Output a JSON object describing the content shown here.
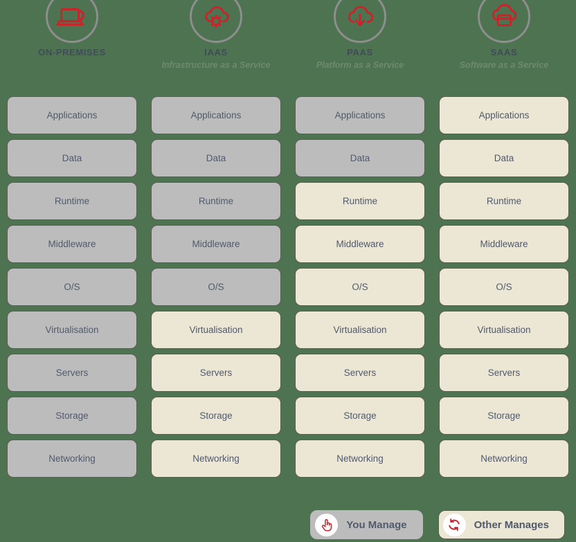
{
  "background_color": "#4d7350",
  "colors": {
    "you_manage_fill": "#bcbcbc",
    "other_manages_fill": "#ece6d4",
    "accent_red": "#cc2229",
    "label_text": "#515a6b",
    "subtitle_text": "#6f8a6f",
    "border": "#5f5a52"
  },
  "columns": [
    {
      "title": "ON-PREMISES",
      "subtitle": "",
      "icon": "laptop-server-icon",
      "cells": [
        {
          "label": "Applications",
          "owner": "you"
        },
        {
          "label": "Data",
          "owner": "you"
        },
        {
          "label": "Runtime",
          "owner": "you"
        },
        {
          "label": "Middleware",
          "owner": "you"
        },
        {
          "label": "O/S",
          "owner": "you"
        },
        {
          "label": "Virtualisation",
          "owner": "you"
        },
        {
          "label": "Servers",
          "owner": "you"
        },
        {
          "label": "Storage",
          "owner": "you"
        },
        {
          "label": "Networking",
          "owner": "you"
        }
      ]
    },
    {
      "title": "IAAS",
      "subtitle": "Infrastructure as a Service",
      "icon": "cloud-gear-icon",
      "cells": [
        {
          "label": "Applications",
          "owner": "you"
        },
        {
          "label": "Data",
          "owner": "you"
        },
        {
          "label": "Runtime",
          "owner": "you"
        },
        {
          "label": "Middleware",
          "owner": "you"
        },
        {
          "label": "O/S",
          "owner": "you"
        },
        {
          "label": "Virtualisation",
          "owner": "other"
        },
        {
          "label": "Servers",
          "owner": "other"
        },
        {
          "label": "Storage",
          "owner": "other"
        },
        {
          "label": "Networking",
          "owner": "other"
        }
      ]
    },
    {
      "title": "PAAS",
      "subtitle": "Platform as a Service",
      "icon": "cloud-download-icon",
      "cells": [
        {
          "label": "Applications",
          "owner": "you"
        },
        {
          "label": "Data",
          "owner": "you"
        },
        {
          "label": "Runtime",
          "owner": "other"
        },
        {
          "label": "Middleware",
          "owner": "other"
        },
        {
          "label": "O/S",
          "owner": "other"
        },
        {
          "label": "Virtualisation",
          "owner": "other"
        },
        {
          "label": "Servers",
          "owner": "other"
        },
        {
          "label": "Storage",
          "owner": "other"
        },
        {
          "label": "Networking",
          "owner": "other"
        }
      ]
    },
    {
      "title": "SAAS",
      "subtitle": "Software as a Service",
      "icon": "cloud-window-icon",
      "cells": [
        {
          "label": "Applications",
          "owner": "other"
        },
        {
          "label": "Data",
          "owner": "other"
        },
        {
          "label": "Runtime",
          "owner": "other"
        },
        {
          "label": "Middleware",
          "owner": "other"
        },
        {
          "label": "O/S",
          "owner": "other"
        },
        {
          "label": "Virtualisation",
          "owner": "other"
        },
        {
          "label": "Servers",
          "owner": "other"
        },
        {
          "label": "Storage",
          "owner": "other"
        },
        {
          "label": "Networking",
          "owner": "other"
        }
      ]
    }
  ],
  "legend": [
    {
      "label": "You Manage",
      "owner": "you",
      "icon": "pointing-hand-icon"
    },
    {
      "label": "Other Manages",
      "owner": "other",
      "icon": "refresh-sync-icon"
    }
  ]
}
